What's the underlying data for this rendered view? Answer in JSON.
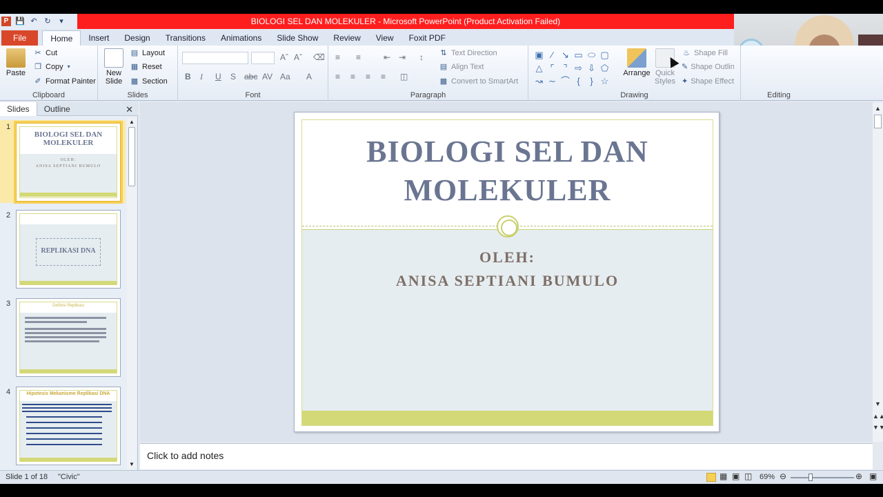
{
  "window": {
    "title": "BIOLOGI SEL DAN MOLEKULER  -  Microsoft PowerPoint (Product Activation Failed)",
    "colors": {
      "title_bar": "#ff1e1e",
      "file_tab": "#d9472b",
      "accent_slide": "#d3d976"
    }
  },
  "quick_access": [
    "powerpoint-logo",
    "save-icon",
    "undo-icon",
    "redo-icon",
    "customize-icon"
  ],
  "tabs": [
    "File",
    "Home",
    "Insert",
    "Design",
    "Transitions",
    "Animations",
    "Slide Show",
    "Review",
    "View",
    "Foxit PDF"
  ],
  "active_tab": "Home",
  "ribbon": {
    "clipboard": {
      "label": "Clipboard",
      "paste": "Paste",
      "cut": "Cut",
      "copy": "Copy",
      "format_painter": "Format Painter"
    },
    "slides": {
      "label": "Slides",
      "new_slide": "New Slide",
      "layout": "Layout",
      "reset": "Reset",
      "section": "Section"
    },
    "font": {
      "label": "Font"
    },
    "paragraph": {
      "label": "Paragraph",
      "text_direction": "Text Direction",
      "align_text": "Align Text",
      "convert_smartart": "Convert to SmartArt"
    },
    "drawing": {
      "label": "Drawing",
      "arrange": "Arrange",
      "quick_styles": "Quick Styles",
      "shape_fill": "Shape Fill",
      "shape_outline": "Shape Outline",
      "shape_effects": "Shape Effects"
    },
    "editing": {
      "label": "Editing"
    }
  },
  "panel": {
    "tab_slides": "Slides",
    "tab_outline": "Outline"
  },
  "thumbnails": [
    {
      "num": "1",
      "title": "BIOLOGI SEL DAN MOLEKULER",
      "sub1": "OLEH:",
      "sub2": "ANISA SEPTIANI BUMULO"
    },
    {
      "num": "2",
      "title": "REPLIKASI DNA"
    },
    {
      "num": "3",
      "title": "Definisi Replikasi"
    },
    {
      "num": "4",
      "title": "Hipotesis Mekanisme Replikasi DNA"
    }
  ],
  "slide": {
    "title_line1": "BIOLOGI SEL DAN",
    "title_line2": "MOLEKULER",
    "subtitle1": "OLEH:",
    "subtitle2": "ANISA SEPTIANI BUMULO"
  },
  "notes": {
    "placeholder": "Click to add notes"
  },
  "status": {
    "slide_info": "Slide 1 of 18",
    "theme": "\"Civic\"",
    "zoom": "69%"
  }
}
